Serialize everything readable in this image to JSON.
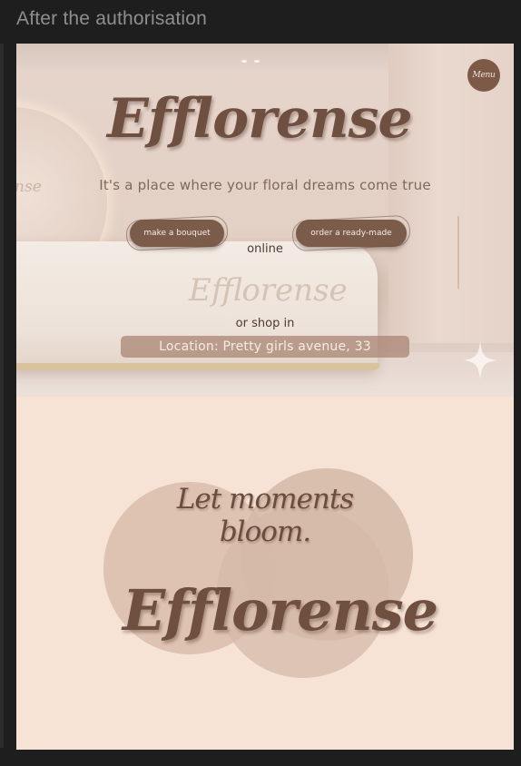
{
  "frame": {
    "title": "After the authorisation"
  },
  "header": {
    "menu_label": "Menu",
    "brand": "Efflorense"
  },
  "hero": {
    "tagline": "It's a place where your floral dreams come true",
    "counter_logo": "Efflorense",
    "arch_text": "ense",
    "buttons": {
      "make_bouquet": "make a bouquet",
      "order_ready": "order a ready-made"
    },
    "online_label": "online",
    "shop_label": "or shop in",
    "location": "Location: Pretty girls avenue, 33"
  },
  "bottom": {
    "slogan": "Let moments bloom.",
    "brand": "Efflorense"
  },
  "colors": {
    "accent": "#7b5c4b",
    "background": "#f6e3d5",
    "text_dark": "#6e4f40"
  }
}
